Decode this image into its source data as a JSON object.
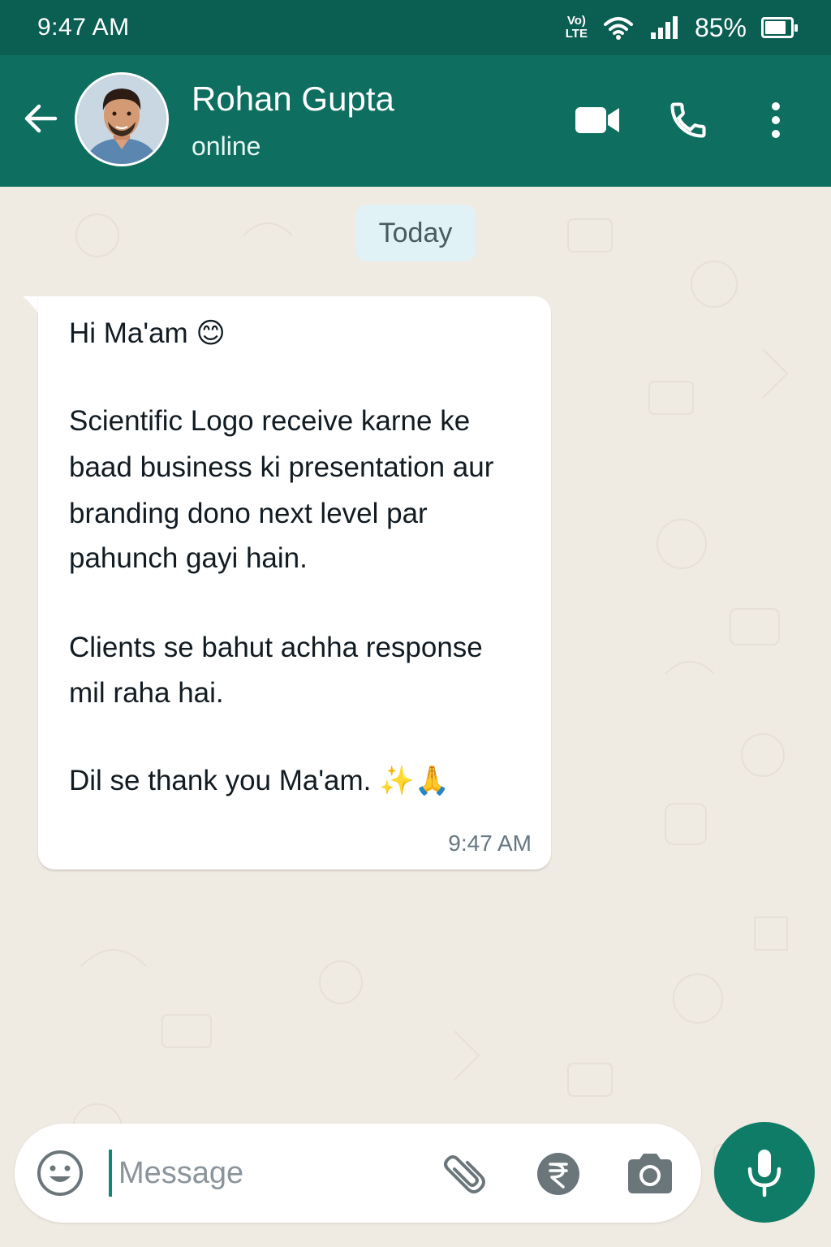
{
  "status_bar": {
    "time": "9:47 AM",
    "volte_top": "Vo)",
    "volte_bottom": "LTE",
    "battery_percent_text": "85%",
    "battery_level": 0.85
  },
  "header": {
    "contact_name": "Rohan Gupta",
    "contact_status": "online",
    "icons": [
      "back-arrow-icon",
      "video-call-icon",
      "phone-icon",
      "more-vert-icon"
    ]
  },
  "chat": {
    "date_label": "Today",
    "message": {
      "lines": [
        "Hi Ma'am 😊",
        "Scientific Logo receive karne ke",
        "baad business ki presentation aur",
        "branding dono next level par",
        "pahunch gayi hain.",
        "Clients se bahut achha response",
        "mil raha hai.",
        "Dil se thank you Ma'am. ✨🙏"
      ],
      "time": "9:47 AM"
    }
  },
  "composer": {
    "placeholder": "Message",
    "value": "",
    "icons": [
      "emoji-icon",
      "attach-icon",
      "rupee-icon",
      "camera-icon",
      "mic-icon"
    ]
  },
  "colors": {
    "status_bar": "#0b5e52",
    "header": "#0e6e5f",
    "wallpaper": "#efeae2",
    "bubble": "#ffffff",
    "mic_button": "#0e7c66",
    "date_chip": "#e1f2f7"
  }
}
